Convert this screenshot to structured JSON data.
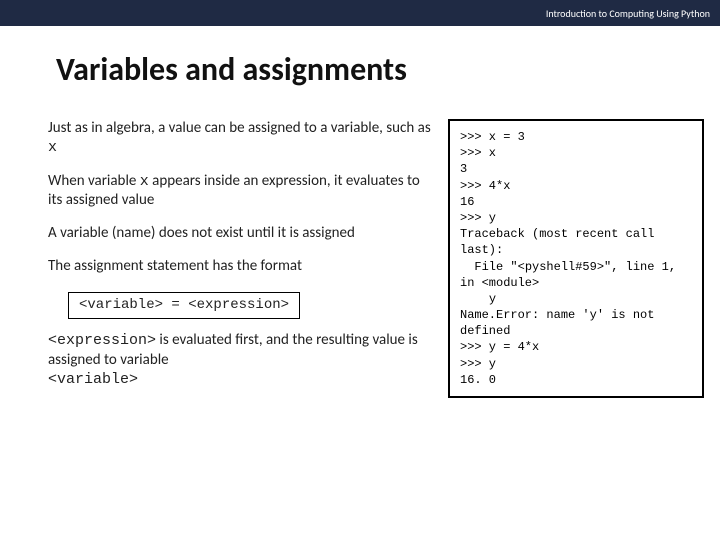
{
  "header": {
    "course_label": "Introduction to Computing Using Python"
  },
  "title": "Variables and assignments",
  "body": {
    "p1_a": "Just as in algebra, a value can be assigned to a variable, such as ",
    "p1_var": "x",
    "p2_a": "When variable ",
    "p2_var": "x",
    "p2_b": " appears inside an expression, it evaluates to its assigned value",
    "p3": "A variable (name) does not exist until it is assigned",
    "p4": "The assignment statement has the format",
    "syntax": "<variable> = <expression>",
    "p5_a": "<expression>",
    "p5_b": " is evaluated first, and the resulting value is assigned to variable ",
    "p5_c": "<variable>"
  },
  "terminal": {
    "content": ">>> x = 3\n>>> x\n3\n>>> 4*x\n16\n>>> y\nTraceback (most recent call last):\n  File \"<pyshell#59>\", line 1, in <module>\n    y\nName.Error: name 'y' is not defined\n>>> y = 4*x\n>>> y\n16. 0"
  }
}
